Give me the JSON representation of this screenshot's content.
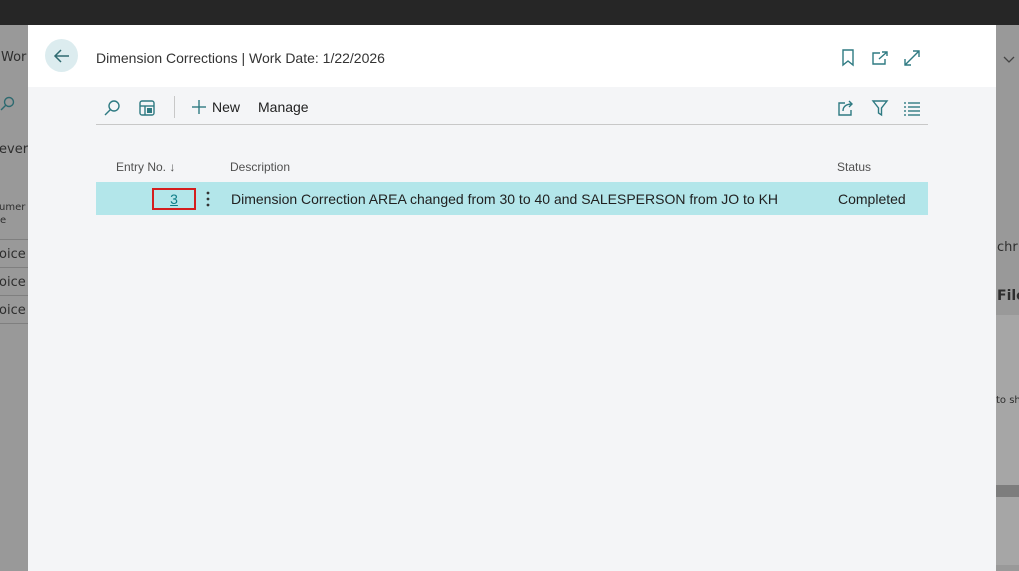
{
  "background": {
    "left_texts": [
      "Wor",
      "ever",
      "umer",
      "e",
      "oice",
      "oice",
      "oice"
    ],
    "right_texts": [
      "chr",
      "File",
      "to sh"
    ]
  },
  "dialog": {
    "title": "Dimension Corrections | Work Date: 1/22/2026",
    "header_icons": [
      "bookmark-icon",
      "open-in-new-window-icon",
      "expand-icon"
    ],
    "back_icon": "arrow-left-icon"
  },
  "actionbar": {
    "search_icon": "search-icon",
    "layout_icon": "edit-in-grid-icon",
    "new_label": "New",
    "manage_label": "Manage",
    "right_icons": [
      "share-icon",
      "filter-icon",
      "list-view-icon"
    ]
  },
  "table": {
    "columns": {
      "entry_no": "Entry No. ↓",
      "description": "Description",
      "status": "Status"
    },
    "rows": [
      {
        "entry_no": "3",
        "description": "Dimension Correction AREA changed from 30 to 40 and SALESPERSON from JO to KH",
        "status": "Completed"
      }
    ]
  },
  "colors": {
    "accent": "#0e7d87",
    "selected_row": "#b3e6ea",
    "highlight_border": "#d41e1e"
  }
}
